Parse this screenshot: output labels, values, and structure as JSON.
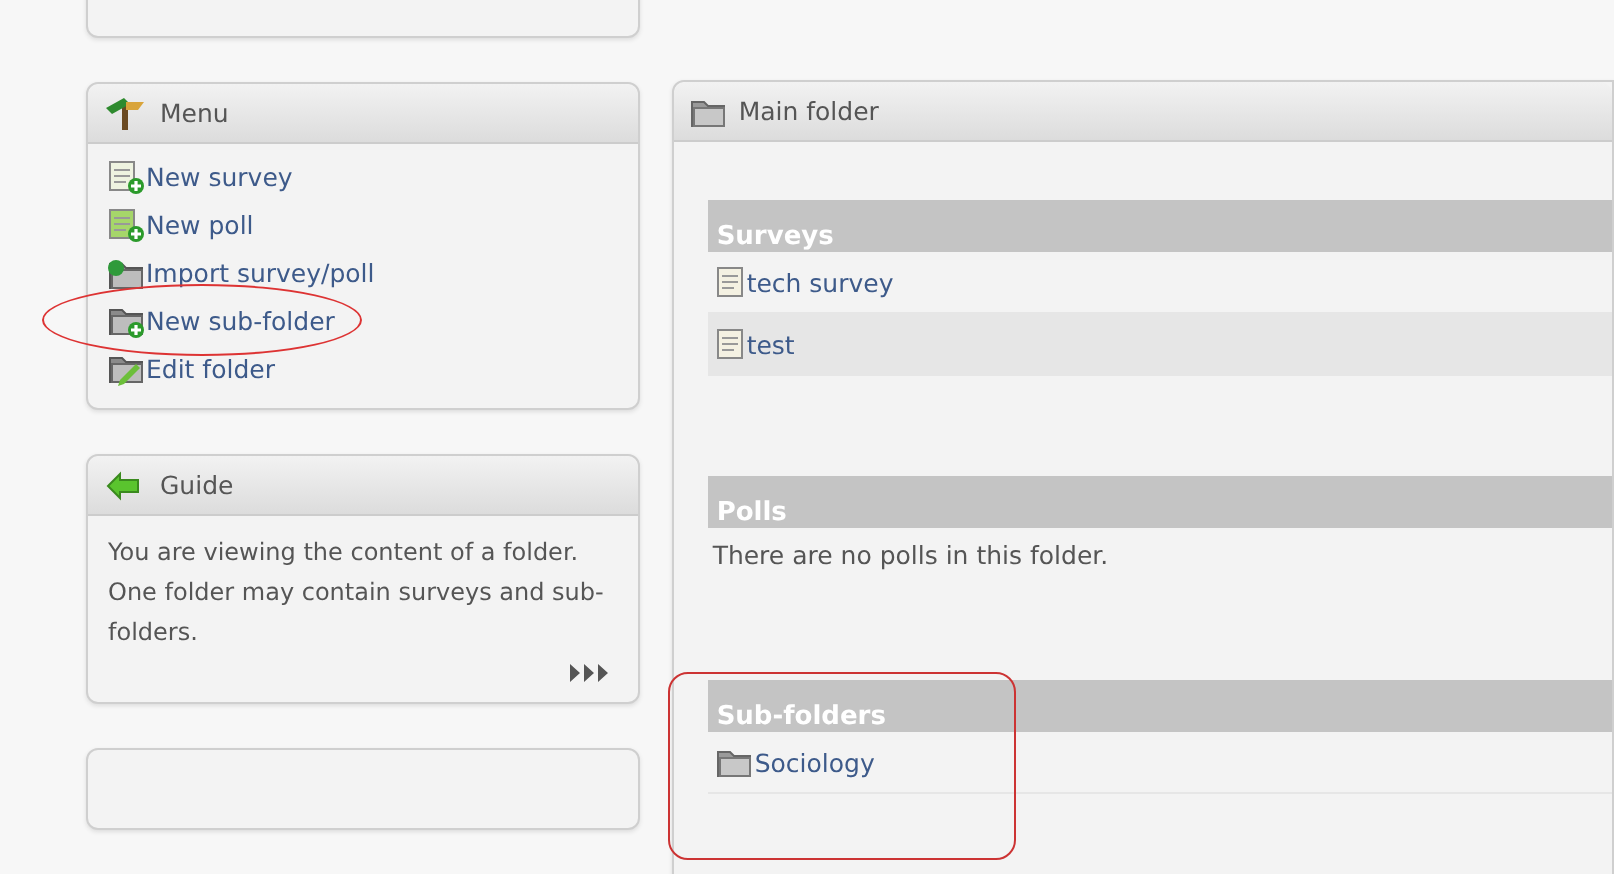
{
  "menu": {
    "title": "Menu",
    "items": [
      {
        "label": "New survey",
        "kind": "survey",
        "highlighted": false
      },
      {
        "label": "New poll",
        "kind": "poll",
        "highlighted": false
      },
      {
        "label": "Import survey/poll",
        "kind": "import",
        "highlighted": false
      },
      {
        "label": "New sub-folder",
        "kind": "subfolder",
        "highlighted": true
      },
      {
        "label": "Edit folder",
        "kind": "edit",
        "highlighted": false
      }
    ]
  },
  "guide": {
    "title": "Guide",
    "text": "You are viewing the content of a folder. One folder may contain surveys and sub-folders."
  },
  "main": {
    "title": "Main folder",
    "sections": [
      {
        "title": "Surveys",
        "kind": "surveys",
        "highlighted": false,
        "items": [
          "tech survey",
          "test"
        ]
      },
      {
        "title": "Polls",
        "highlighted": false,
        "empty_text": "There are no polls in this folder."
      },
      {
        "title": "Sub-folders",
        "kind": "folders",
        "highlighted": true,
        "items": [
          "Sociology"
        ]
      }
    ]
  }
}
